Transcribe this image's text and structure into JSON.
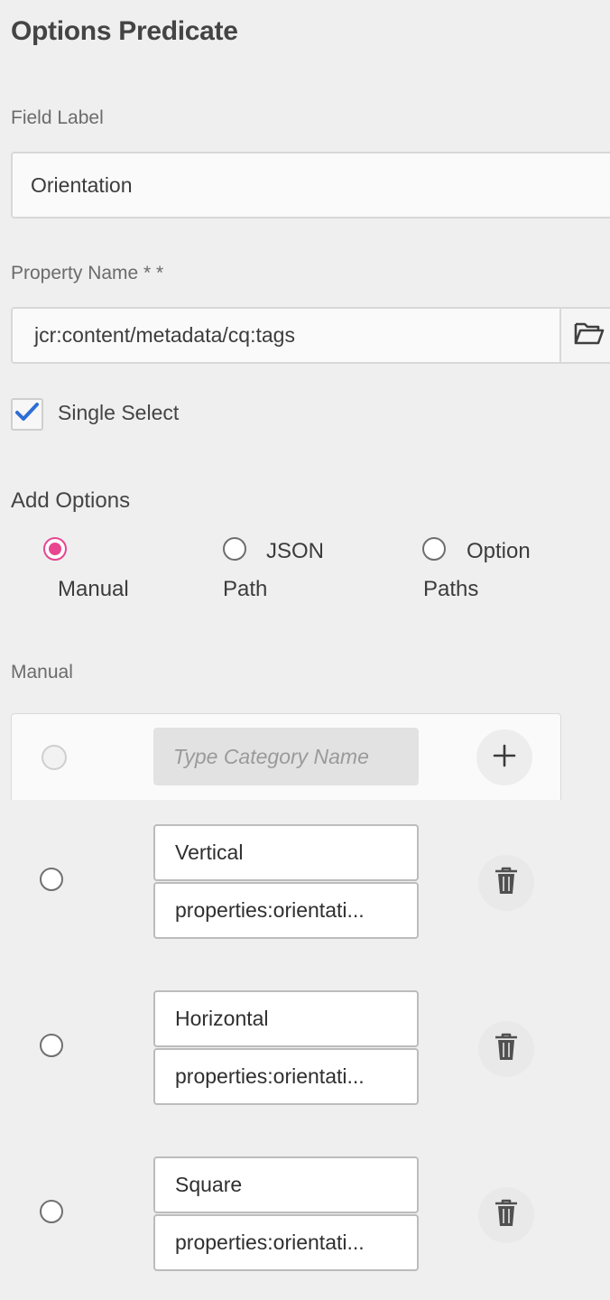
{
  "title": "Options Predicate",
  "field_label": {
    "label": "Field Label",
    "value": "Orientation"
  },
  "property_name": {
    "label": "Property Name * *",
    "value": "jcr:content/metadata/cq:tags"
  },
  "single_select": {
    "label": "Single Select",
    "checked": true
  },
  "add_options": {
    "heading": "Add Options",
    "choices": [
      {
        "line1": "",
        "line2": "Manual",
        "selected": true
      },
      {
        "line1": "JSON",
        "line2": "Path",
        "selected": false
      },
      {
        "line1": "Option",
        "line2": "Paths",
        "selected": false
      }
    ]
  },
  "manual": {
    "label": "Manual",
    "new_option_placeholder": "Type Category Name",
    "options": [
      {
        "name": "Vertical",
        "value": "properties:orientati..."
      },
      {
        "name": "Horizontal",
        "value": "properties:orientati..."
      },
      {
        "name": "Square",
        "value": "properties:orientati..."
      }
    ]
  },
  "colors": {
    "accent_radio": "#e8468f",
    "check": "#2d6ed6"
  },
  "icons": {
    "browse": "folder-icon",
    "add": "plus-icon",
    "delete": "trash-icon",
    "checkbox": "checkmark-icon"
  }
}
